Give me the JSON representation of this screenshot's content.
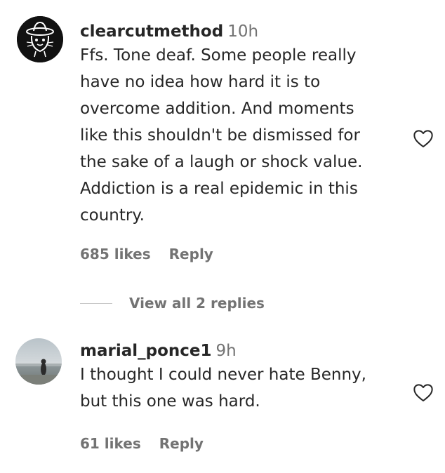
{
  "comments": [
    {
      "username": "clearcutmethod",
      "time": "10h",
      "text": "Ffs. Tone deaf. Some people really\nhave no idea how hard it is to\novercome addition. And moments\nlike this shouldn't be dismissed for\nthe sake of a laugh or shock value.\nAddiction is a real epidemic in this\ncountry.",
      "likes": "685 likes",
      "reply_label": "Reply",
      "avatar_icon": "sombrero-cat-logo-icon",
      "view_replies": "View all 2 replies"
    },
    {
      "username": "marial_ponce1",
      "time": "9h",
      "text": "I thought I could never hate Benny,\nbut this one was hard.",
      "likes": "61 likes",
      "reply_label": "Reply",
      "avatar_icon": "beach-photo-avatar"
    }
  ],
  "colors": {
    "primary_text": "#262626",
    "secondary_text": "#737373",
    "divider": "#c7c7c7"
  }
}
